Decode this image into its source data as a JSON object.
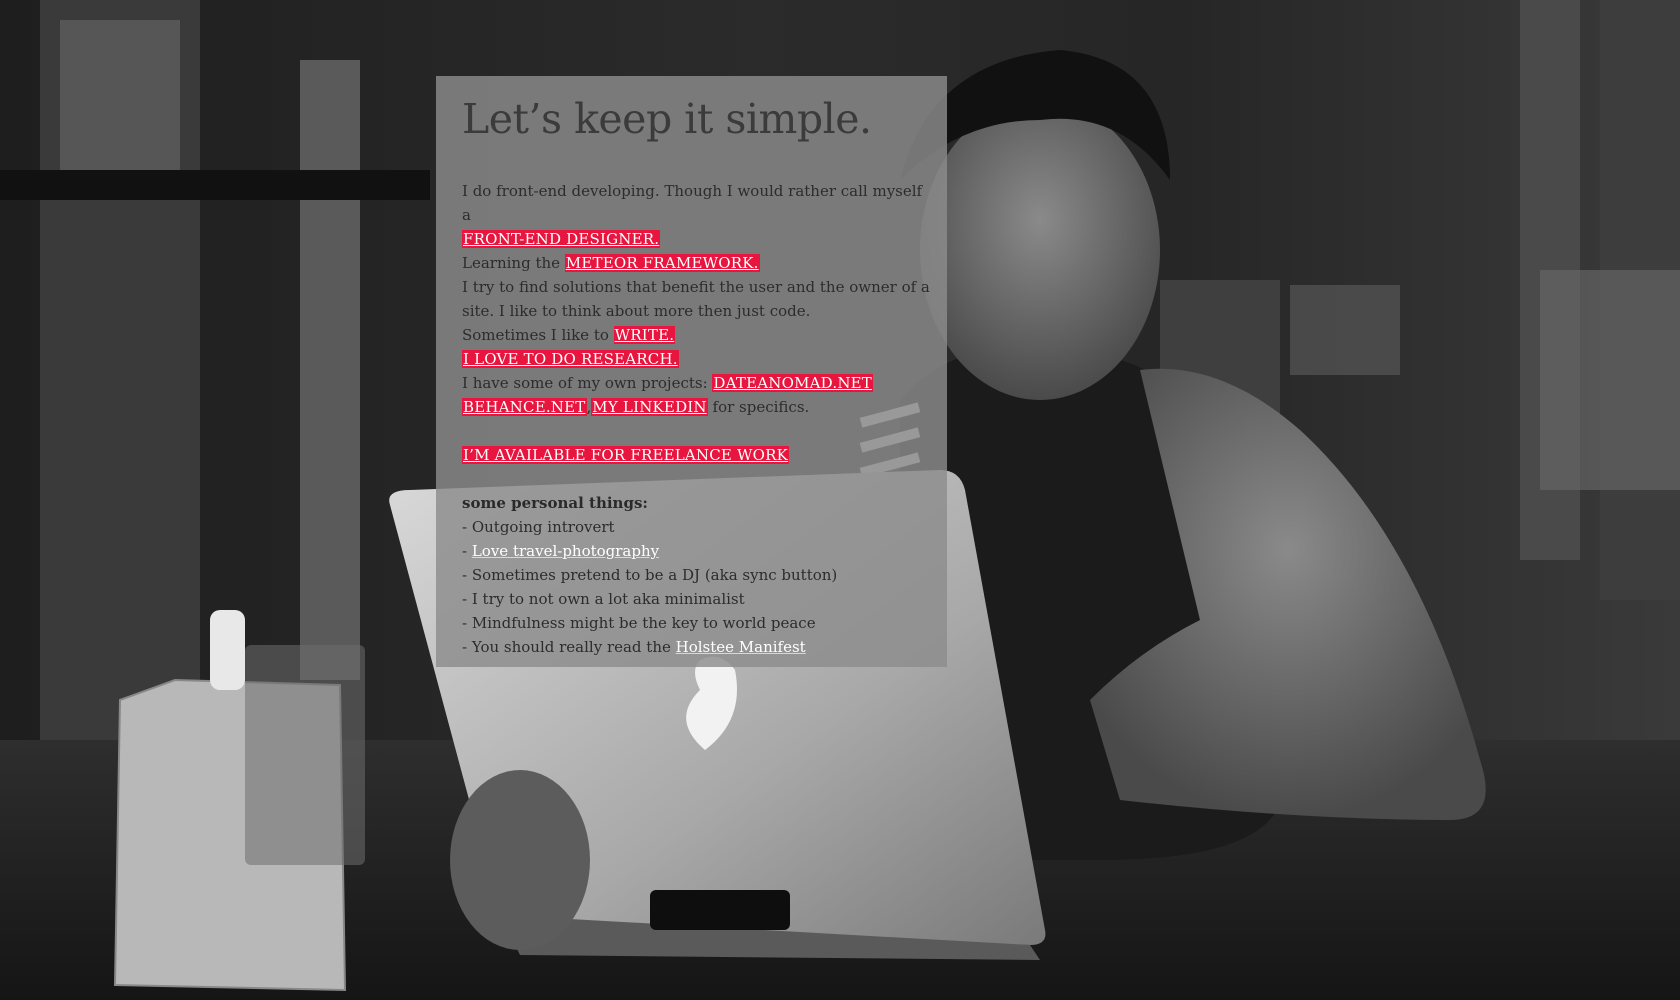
{
  "title": "Let’s keep it simple.",
  "intro": {
    "line1_text": "I do front-end developing. Though I would rather call myself a",
    "designer_link": "FRONT-END DESIGNER.",
    "learning_text": "Learning the ",
    "meteor_link": "METEOR FRAMEWORK.",
    "solutions_text": "I try to find solutions that benefit the user and the owner of a site. I like to think about more then just code.",
    "sometimes_text": "Sometimes I like to ",
    "write_link": "WRITE.",
    "research_link": "I LOVE TO DO RESEARCH.",
    "projects_text": "I have some of my own projects: ",
    "dateanomad_link": "DATEANOMAD.NET",
    "behance_link": "BEHANCE.NET",
    "comma": ",",
    "linkedin_link": "MY LINKEDIN",
    "specifics_text": " for specifics."
  },
  "freelance_link": "I’M AVAILABLE FOR FREELANCE WORK",
  "personal": {
    "heading": "some personal things:",
    "items": [
      {
        "prefix": "- ",
        "text": "Outgoing introvert"
      },
      {
        "prefix": "- ",
        "link": "Love travel-photography"
      },
      {
        "prefix": "- ",
        "text": "Sometimes pretend to be a DJ (aka sync button)"
      },
      {
        "prefix": "- ",
        "text": "I try to not own a lot aka minimalist"
      },
      {
        "prefix": "- ",
        "text": "Mindfulness might be the key to world peace"
      },
      {
        "prefix": "- ",
        "text": "You should really read the ",
        "link": "Holstee Manifest"
      }
    ]
  },
  "colors": {
    "accent": "#e8153e",
    "panel": "#8c8c8c"
  }
}
